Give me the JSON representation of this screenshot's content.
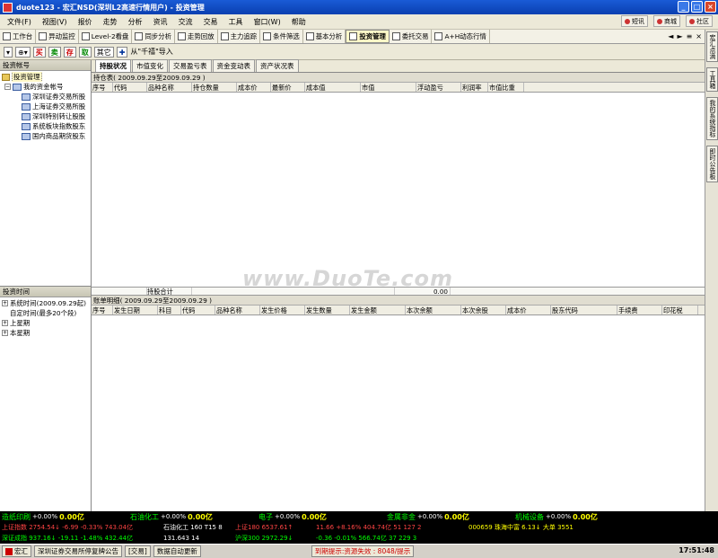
{
  "title": {
    "text": "duote123 - 宏汇NSD(深圳L2高速行情用户) - 投资管理",
    "buttons": [
      "_",
      "□",
      "×"
    ]
  },
  "menu": [
    "文件(F)",
    "视图(V)",
    "报价",
    "走势",
    "分析",
    "资讯",
    "交流",
    "交易",
    "工具",
    "窗口(W)",
    "帮助"
  ],
  "right_links": [
    "短讯",
    "商城",
    "社区"
  ],
  "tabs": [
    "工作台",
    "异动监控",
    "Level-2看盘",
    "同步分析",
    "走势回放",
    "主力追踪",
    "条件筛选",
    "基本分析",
    "投资管理",
    "委托交易",
    "A+H动态行情"
  ],
  "active_tab": "投资管理",
  "tab_nav": [
    "◄",
    "►",
    "≡",
    "×"
  ],
  "toolbar2": {
    "buttons": [
      "买",
      "卖",
      "存",
      "取",
      "其它"
    ],
    "import_label": "从\"千禧\"导入"
  },
  "left": {
    "header": "投资帐号",
    "tree": [
      {
        "label": "投资管理",
        "level": 0,
        "kind": "folder",
        "selected": true
      },
      {
        "label": "我的资金帐号",
        "level": 1,
        "kind": "account",
        "expanded": true
      },
      {
        "label": "深圳证券交易所股",
        "level": 2,
        "kind": "item"
      },
      {
        "label": "上海证券交易所股",
        "level": 2,
        "kind": "item"
      },
      {
        "label": "深圳特别转让股股",
        "level": 2,
        "kind": "item"
      },
      {
        "label": "系统板块指数股东",
        "level": 2,
        "kind": "item"
      },
      {
        "label": "国内商品期货股东",
        "level": 2,
        "kind": "item"
      }
    ],
    "time_header": "投资时间",
    "time_items": [
      "系统时间(2009.09.29起)",
      "自定时间(最多20个段)",
      "上星期",
      "本星期"
    ]
  },
  "subtabs": [
    "持股状况",
    "市值变化",
    "交易盈亏表",
    "资金变动表",
    "资产状况表"
  ],
  "active_subtab": "持股状况",
  "holdings": {
    "header": "持仓表( 2009.09.29至2009.09.29 )",
    "columns": [
      "序号",
      "代码",
      "品种名称",
      "持仓数量",
      "成本价",
      "最新价",
      "成本值",
      "市值",
      "浮动盈亏",
      "利润率",
      "市值比重"
    ],
    "summary_label": "持股合计",
    "summary_value": "0.00"
  },
  "flows": {
    "header": "账单明细( 2009.09.29至2009.09.29 )",
    "columns": [
      "序号",
      "发生日期",
      "科目",
      "代码",
      "品种名称",
      "发生价格",
      "发生数量",
      "发生金额",
      "本次余额",
      "本次余股",
      "成本价",
      "股东代码",
      "手续费",
      "印花税"
    ]
  },
  "side_tabs": [
    "宏汇点滴",
    "工具箱",
    "我的系统指标",
    "即时公告板"
  ],
  "ticker": {
    "row1": [
      {
        "name": "造纸印刷",
        "pct": "+0.00%",
        "val": "0.00亿"
      },
      {
        "name": "石油化工",
        "pct": "+0.00%",
        "val": "0.00亿"
      },
      {
        "name": "电子",
        "pct": "+0.00%",
        "val": "0.00亿"
      },
      {
        "name": "金属非金",
        "pct": "+0.00%",
        "val": "0.00亿"
      },
      {
        "name": "机械设备",
        "pct": "+0.00%",
        "val": "0.00亿"
      }
    ],
    "row2": [
      "上证指数 2754.54↓ -6.99 -0.33% 743.04亿",
      "石油化工 160 T15 8",
      "上证180 6537.61↑",
      "11.66 +8.16% 404.74亿 51 127 2",
      "000659 珠海中富 6.13↓ 大单 3551"
    ],
    "row3": [
      "深证成指 937.16↓ -19.11 -1.48% 432.44亿",
      "131.643 14",
      "沪深300 2972.29↓",
      "-0.36 -0.01% 566.74亿 37 229 3",
      ""
    ]
  },
  "taskbar": {
    "start": "宏汇",
    "items": [
      "深圳证券交易所停复牌公告",
      "[交易]",
      "数据自动更新"
    ],
    "status": "到期提示:资源失效 : 8048/提示",
    "clock": "17:51:48"
  },
  "watermark": "www.DuoTe.com"
}
